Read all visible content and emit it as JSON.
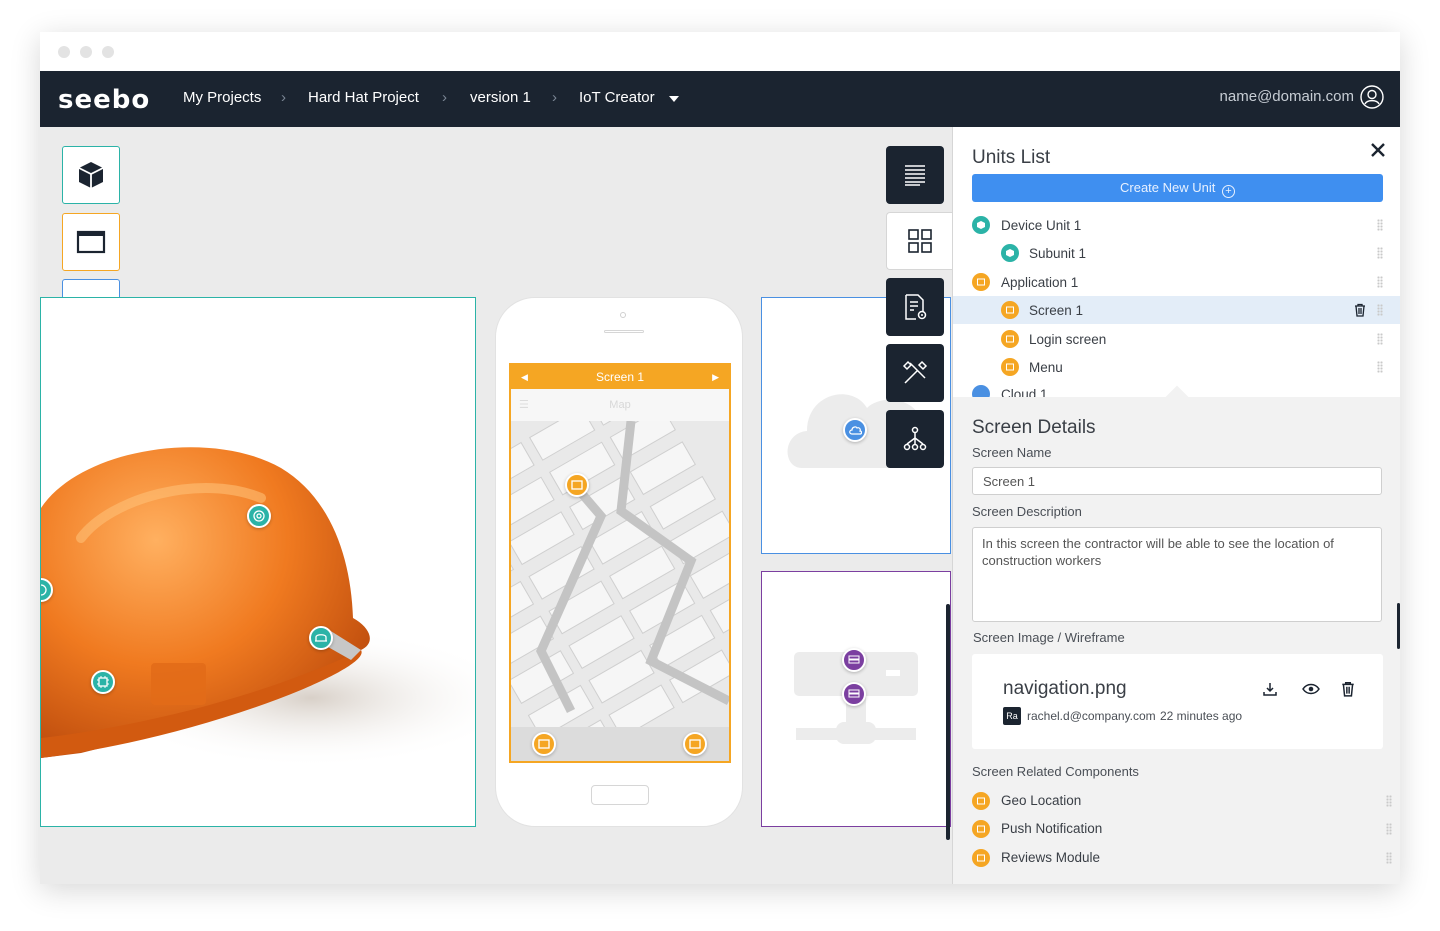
{
  "colors": {
    "navbar": "#1b2430",
    "device": "#2bb3a7",
    "application": "#f5a623",
    "cloud": "#4a90e2",
    "server": "#7b3fa0",
    "primary_button": "#3f8ff0"
  },
  "navbar": {
    "logo": "seebo",
    "breadcrumbs": [
      "My Projects",
      "Hard Hat Project",
      "version 1",
      "IoT Creator"
    ],
    "dropdown_icon": "caret-down-icon",
    "user_email": "name@domain.com",
    "user_icon": "user-circle-icon"
  },
  "canvas": {
    "left_tools": [
      {
        "name": "device-tool",
        "icon": "cube-icon"
      },
      {
        "name": "application-tool",
        "icon": "window-icon"
      },
      {
        "name": "cloud-tool",
        "icon": "cloud-icon"
      },
      {
        "name": "server-tool",
        "icon": "server-icon"
      }
    ],
    "right_tools": [
      {
        "name": "list-view",
        "icon": "text-lines-icon"
      },
      {
        "name": "grid-view",
        "icon": "grid-icon"
      },
      {
        "name": "document-settings",
        "icon": "document-gear-icon"
      },
      {
        "name": "tools",
        "icon": "tools-icon"
      },
      {
        "name": "hierarchy",
        "icon": "hierarchy-icon"
      }
    ],
    "phone": {
      "screen_title": "Screen 1",
      "sub_title": "Map"
    }
  },
  "units_list": {
    "title": "Units List",
    "create_button": "Create New Unit",
    "items": [
      {
        "label": "Device Unit 1",
        "type": "device",
        "level": 0
      },
      {
        "label": "Subunit 1",
        "type": "device",
        "level": 1
      },
      {
        "label": "Application 1",
        "type": "application",
        "level": 0
      },
      {
        "label": "Screen 1",
        "type": "application",
        "level": 1,
        "selected": true
      },
      {
        "label": "Login screen",
        "type": "application",
        "level": 1
      },
      {
        "label": "Menu",
        "type": "application",
        "level": 1
      },
      {
        "label": "Cloud 1",
        "type": "cloud",
        "level": 0
      }
    ]
  },
  "screen_details": {
    "title": "Screen Details",
    "name_label": "Screen Name",
    "name_value": "Screen 1",
    "description_label": "Screen Description",
    "description_value": "In this screen the contractor will be able to see the location of construction workers",
    "image_label": "Screen Image /  Wireframe",
    "file": {
      "name": "navigation.png",
      "avatar": "Ra",
      "uploader": "rachel.d@company.com",
      "time": "22 minutes ago"
    },
    "related_label": "Screen Related Components",
    "related": [
      "Geo Location",
      "Push Notification",
      "Reviews Module"
    ]
  }
}
